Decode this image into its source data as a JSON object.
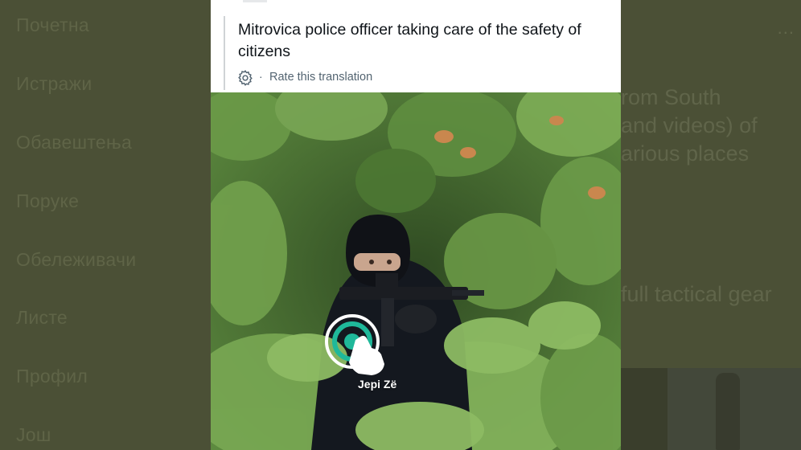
{
  "sidebar": {
    "items": [
      {
        "label": "Почетна"
      },
      {
        "label": "Истражи"
      },
      {
        "label": "Обавештења"
      },
      {
        "label": "Поруке"
      },
      {
        "label": "Обележивачи"
      },
      {
        "label": "Листе"
      },
      {
        "label": "Профил"
      },
      {
        "label": "Још"
      }
    ]
  },
  "background_post": {
    "lines": [
      "rom South",
      "and videos) of",
      "arious places",
      "full tactical gear"
    ],
    "more_label": "..."
  },
  "translation": {
    "text": "Mitrovica police officer taking care of the safety of citizens",
    "rate_label": "Rate this translation",
    "separator": "·"
  },
  "photo": {
    "watermark": "Jepi Zë",
    "watermark_color": "#1fb89a"
  },
  "colors": {
    "overlay": "#4b5036",
    "card_bg": "#ffffff",
    "text_primary": "#0f1419",
    "text_secondary": "#536471"
  },
  "icons": {
    "translation_settings": "gear-icon",
    "watermark": "tap-hand-icon"
  }
}
